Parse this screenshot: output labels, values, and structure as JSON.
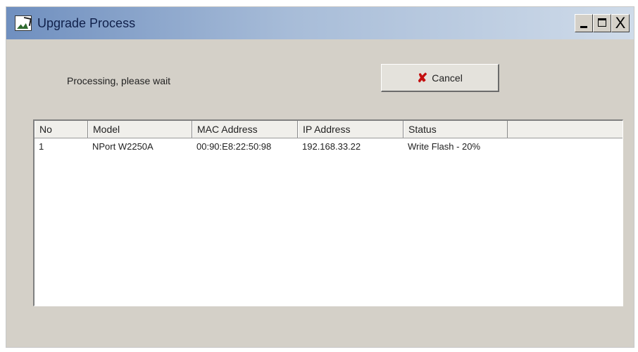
{
  "window": {
    "title": "Upgrade Process",
    "icon": "app-icon",
    "controls": {
      "minimize": "_",
      "maximize": "□",
      "close": "X"
    }
  },
  "status_message": "Processing, please wait",
  "cancel_button": {
    "label": "Cancel",
    "icon": "x-icon",
    "icon_glyph": "✘",
    "icon_color": "#c41010"
  },
  "table": {
    "columns": [
      "No",
      "Model",
      "MAC Address",
      "IP Address",
      "Status"
    ],
    "rows": [
      [
        "1",
        "NPort W2250A",
        "00:90:E8:22:50:98",
        "192.168.33.22",
        "Write Flash - 20%"
      ]
    ]
  }
}
